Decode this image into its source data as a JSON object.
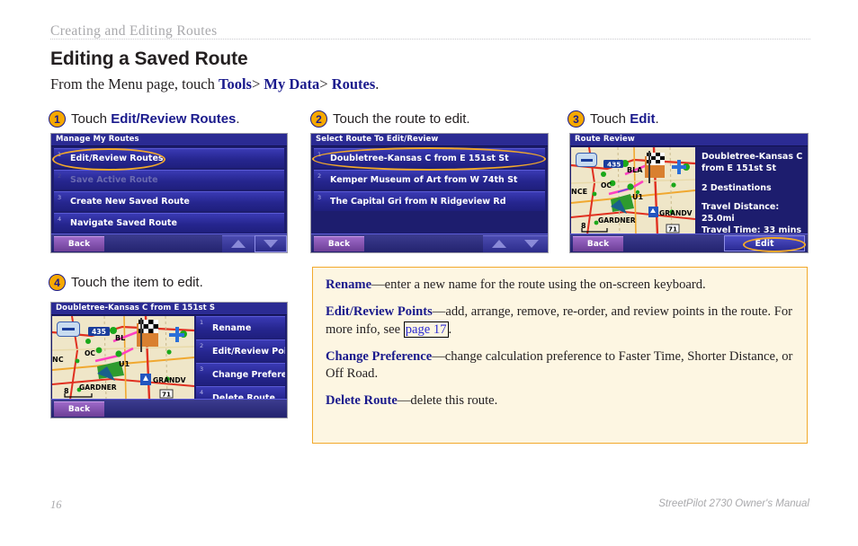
{
  "header": {
    "running_head": "Creating and Editing Routes",
    "title": "Editing a Saved Route",
    "intro_prefix": "From the Menu page, touch ",
    "intro_path": [
      "Tools",
      "My Data",
      "Routes"
    ],
    "intro_separator": ">",
    "intro_suffix": "."
  },
  "colors": {
    "link_blue": "#1a1a8c",
    "highlight_orange": "#f2a92b",
    "callout_bg": "#fdf6e2",
    "device_blue": "#2b2b93",
    "back_purple": "#6c3e96",
    "gray_text": "#a9a9ac"
  },
  "steps": [
    {
      "number": "1",
      "caption_prefix": "Touch ",
      "caption_bold": "Edit/Review Routes",
      "caption_suffix": ".",
      "screen": {
        "title": "Manage My Routes",
        "rows": [
          {
            "index": "1",
            "label": "Edit/Review Routes",
            "state": "highlighted"
          },
          {
            "index": "2",
            "label": "Save Active Route",
            "state": "disabled"
          },
          {
            "index": "3",
            "label": "Create New Saved Route",
            "state": "normal"
          },
          {
            "index": "4",
            "label": "Navigate Saved Route",
            "state": "normal"
          }
        ],
        "back_label": "Back",
        "scroll_up_icon": "arrow-up-icon",
        "scroll_down_icon": "arrow-down-icon",
        "scroll_down_focused": true
      }
    },
    {
      "number": "2",
      "caption_prefix": "Touch the route to edit.",
      "caption_bold": "",
      "caption_suffix": "",
      "screen": {
        "title": "Select Route To Edit/Review",
        "rows": [
          {
            "index": "1",
            "label": "Doubletree-Kansas C from E 151st St",
            "state": "highlighted"
          },
          {
            "index": "2",
            "label": "Kemper Museum of Art from W 74th St",
            "state": "normal"
          },
          {
            "index": "3",
            "label": "The Capital Gri from N Ridgeview Rd",
            "state": "normal"
          },
          {
            "index": "",
            "label": "",
            "state": "empty"
          }
        ],
        "back_label": "Back",
        "scroll_up_icon": "arrow-up-icon",
        "scroll_down_icon": "arrow-down-icon",
        "scroll_down_focused": false
      }
    },
    {
      "number": "3",
      "caption_prefix": "Touch ",
      "caption_bold": "Edit",
      "caption_suffix": ".",
      "screen": {
        "title": "Route Review",
        "route_name_line1": "Doubletree-Kansas C",
        "route_name_line2": "from E 151st St",
        "destinations": "2 Destinations",
        "travel_distance": "Travel Distance: 25.0mi",
        "travel_time": "Travel Time: 33 mins",
        "back_label": "Back",
        "edit_label": "Edit",
        "zoom_out_icon": "minus-icon",
        "zoom_in_icon": "plus-icon",
        "map_labels": [
          "435",
          "BLA",
          "NCE",
          "OC",
          "U1",
          "GRANDV",
          "GARDNER",
          "71",
          "8"
        ],
        "map_scale": "8"
      }
    },
    {
      "number": "4",
      "caption_prefix": "Touch the item to edit.",
      "caption_bold": "",
      "caption_suffix": "",
      "screen": {
        "title": "Doubletree-Kansas C from E 151st S",
        "rows": [
          {
            "index": "1",
            "label": "Rename",
            "state": "normal"
          },
          {
            "index": "2",
            "label": "Edit/Review Points",
            "state": "normal"
          },
          {
            "index": "3",
            "label": "Change Preference",
            "state": "normal"
          },
          {
            "index": "4",
            "label": "Delete Route",
            "state": "normal"
          }
        ],
        "back_label": "Back",
        "zoom_out_icon": "minus-icon",
        "zoom_in_icon": "plus-icon",
        "map_labels": [
          "435",
          "BLA",
          "NC",
          "OC",
          "U1",
          "GRANDV",
          "GARDNER",
          "71",
          "8"
        ],
        "map_scale": "8"
      }
    }
  ],
  "callout": {
    "items": [
      {
        "term": "Rename",
        "dash": "—",
        "text": "enter a new name for the route using the on-screen keyboard."
      },
      {
        "term": "Edit/Review Points",
        "dash": "—",
        "text": "add, arrange, remove, re-order, and review points in the route. For more info, see ",
        "link": "page 17",
        "text_after": "."
      },
      {
        "term": "Change Preference",
        "dash": "—",
        "text": "change calculation preference to Faster Time, Shorter Distance, or Off Road."
      },
      {
        "term": "Delete Route",
        "dash": "—",
        "text": "delete this route."
      }
    ]
  },
  "footer": {
    "page_number": "16",
    "manual_title": "StreetPilot 2730 Owner's Manual"
  }
}
